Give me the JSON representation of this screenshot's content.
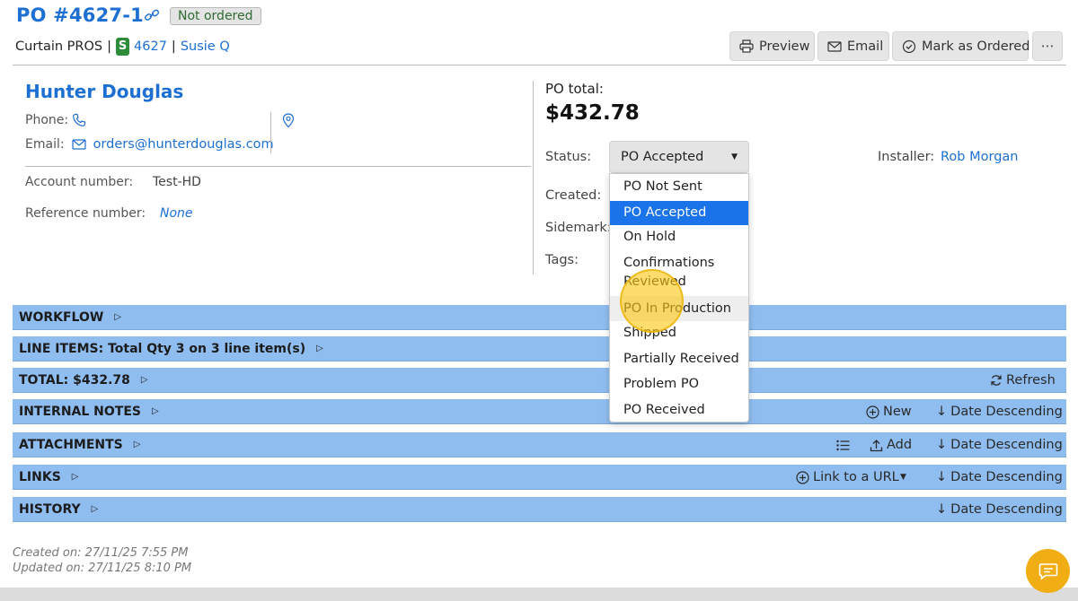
{
  "header": {
    "po_number": "PO #4627-1",
    "status_badge": "Not ordered",
    "company": "Curtain PROS",
    "separator": "|",
    "s_badge": "S",
    "job_number": "4627",
    "customer": "Susie Q",
    "buttons": {
      "preview": "Preview",
      "email": "Email",
      "mark_ordered": "Mark as Ordered",
      "more": "⋯"
    }
  },
  "vendor": {
    "name": "Hunter Douglas",
    "phone_label": "Phone:",
    "email_label": "Email:",
    "email": "orders@hunterdouglas.com",
    "account_label": "Account number:",
    "account_value": "Test-HD",
    "reference_label": "Reference number:",
    "reference_value": "None"
  },
  "po": {
    "total_label": "PO total:",
    "total_value": "$432.78",
    "status_label": "Status:",
    "status_value": "PO Accepted",
    "created_label": "Created:",
    "sidemark_label": "Sidemark:",
    "tags_label": "Tags:",
    "installer_label": "Installer:",
    "installer_value": "Rob Morgan"
  },
  "status_options": [
    {
      "label": "PO Not Sent",
      "state": "normal"
    },
    {
      "label": "PO Accepted",
      "state": "selected"
    },
    {
      "label": "On Hold",
      "state": "normal"
    },
    {
      "label": "Confirmations Reviewed",
      "state": "normal"
    },
    {
      "label": "PO In Production",
      "state": "hover"
    },
    {
      "label": "Shipped",
      "state": "normal"
    },
    {
      "label": "Partially Received",
      "state": "normal"
    },
    {
      "label": "Problem PO",
      "state": "normal"
    },
    {
      "label": "PO Received",
      "state": "normal"
    }
  ],
  "sections": {
    "workflow": "WORKFLOW",
    "line_items": "LINE ITEMS: Total Qty 3 on 3 line item(s)",
    "total": "TOTAL: $432.78",
    "total_refresh": "Refresh",
    "internal_notes": "INTERNAL NOTES",
    "notes_new": "New",
    "notes_sort": "Date Descending",
    "attachments": "ATTACHMENTS",
    "attach_add": "Add",
    "attach_sort": "Date Descending",
    "links": "LINKS",
    "links_url": "Link to a URL",
    "links_sort": "Date Descending",
    "history": "HISTORY",
    "history_sort": "Date Descending"
  },
  "footer": {
    "created_on": "Created on: 27/11/25 7:55 PM",
    "updated_on": "Updated on: 27/11/25 8:10 PM"
  },
  "colors": {
    "accent": "#1d6fd1",
    "section_bar": "#8fbdf0",
    "selected_option": "#1a73e8",
    "cursor_highlight": "#f5c518",
    "chat_button": "#f0ae14"
  }
}
